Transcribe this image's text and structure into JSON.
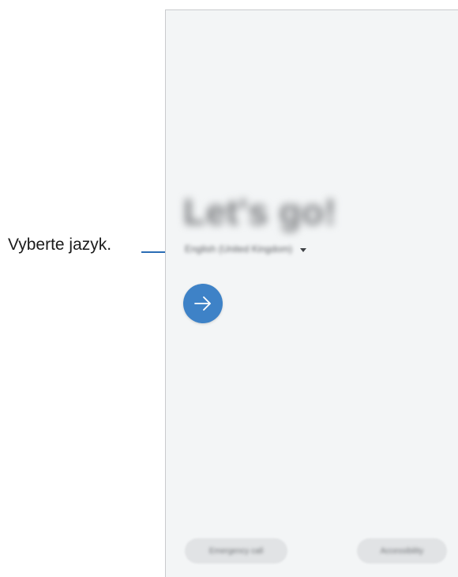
{
  "callout": {
    "text": "Vyberte jazyk."
  },
  "screen": {
    "title": "Let's go!",
    "language_selected": "English (United Kingdom)",
    "next_icon": "arrow-right-icon",
    "buttons": {
      "emergency_call": "Emergency call",
      "accessibility": "Accessibility"
    }
  },
  "colors": {
    "accent": "#3e82c7",
    "screen_background": "#f3f5f6",
    "callout_line": "#2b6db5"
  }
}
